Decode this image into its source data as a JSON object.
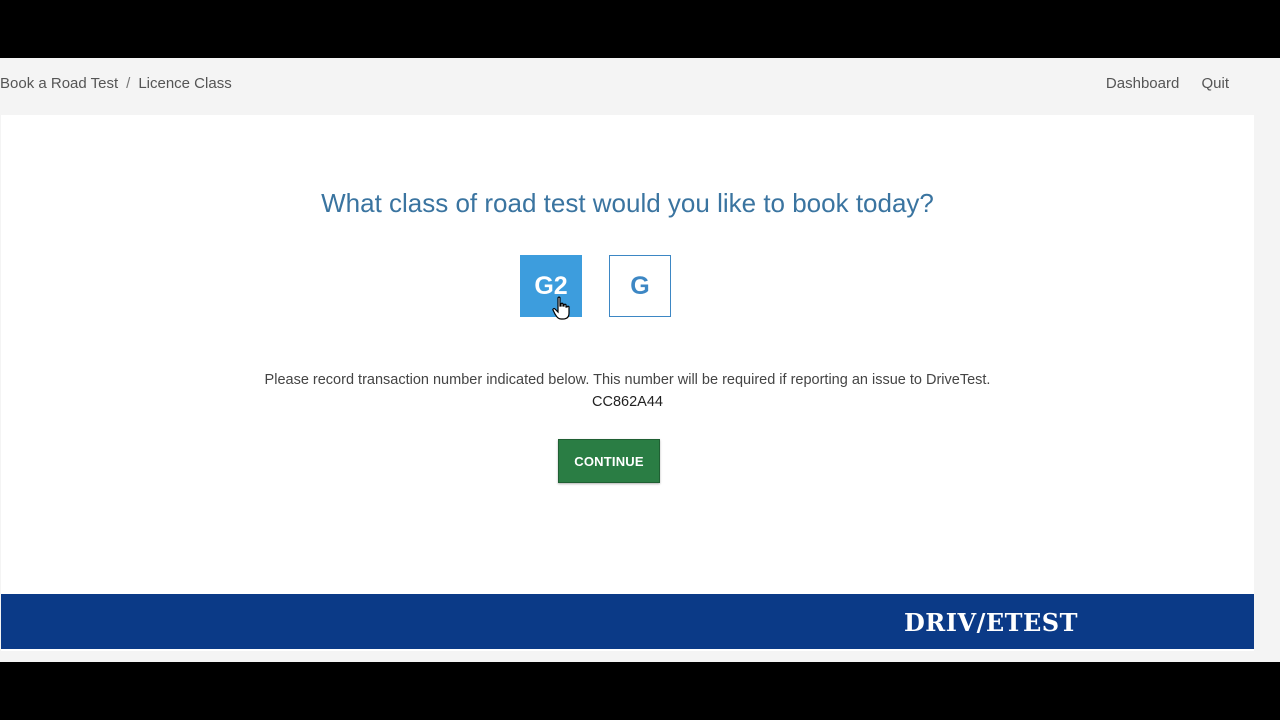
{
  "breadcrumb": {
    "items": [
      "Book a Road Test",
      "Licence Class"
    ],
    "separator": "/"
  },
  "nav": {
    "dashboard": "Dashboard",
    "quit": "Quit"
  },
  "main": {
    "question": "What class of road test would you like to book today?",
    "class_options": [
      {
        "label": "G2",
        "selected": true
      },
      {
        "label": "G",
        "selected": false
      }
    ],
    "notice": "Please record transaction number indicated below. This number will be required if reporting an issue to DriveTest.",
    "transaction_number": "CC862A44",
    "continue_label": "CONTINUE"
  },
  "footer": {
    "logo_text": "DRIVETEST"
  },
  "colors": {
    "question_text": "#3a74a0",
    "selected_option": "#3d9ddd",
    "continue_button": "#2a7d44",
    "footer_bar": "#0b3a87"
  },
  "icons": {
    "cursor": "hand-pointer-icon"
  }
}
